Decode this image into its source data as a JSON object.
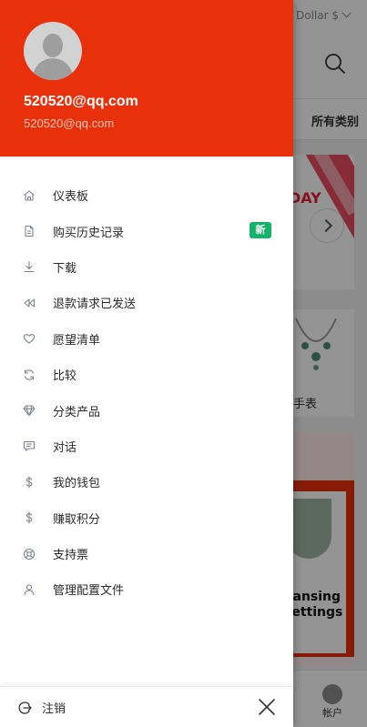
{
  "background": {
    "currency_label": "Dollar $",
    "nav_label": "所有类别",
    "banner_text": "DAY",
    "product_label": "手表",
    "promo_text_line1": "eansing",
    "promo_text_line2": "settings",
    "account_label": "帐户"
  },
  "drawer": {
    "user_name": "520520@qq.com",
    "user_email": "520520@qq.com",
    "menu": [
      {
        "label": "仪表板",
        "icon": "home-icon"
      },
      {
        "label": "购买历史记录",
        "icon": "document-icon",
        "badge": "新"
      },
      {
        "label": "下载",
        "icon": "download-icon"
      },
      {
        "label": "退款请求已发送",
        "icon": "rewind-icon"
      },
      {
        "label": "愿望清单",
        "icon": "heart-icon"
      },
      {
        "label": "比较",
        "icon": "refresh-icon"
      },
      {
        "label": "分类产品",
        "icon": "diamond-icon"
      },
      {
        "label": "对话",
        "icon": "chat-icon"
      },
      {
        "label": "我的钱包",
        "icon": "dollar-icon"
      },
      {
        "label": "赚取积分",
        "icon": "dollar-icon"
      },
      {
        "label": "支持票",
        "icon": "support-icon"
      },
      {
        "label": "管理配置文件",
        "icon": "user-icon"
      }
    ],
    "logout_label": "注销"
  },
  "colors": {
    "header_red": "#e8300b",
    "badge_green": "#12b26b"
  }
}
